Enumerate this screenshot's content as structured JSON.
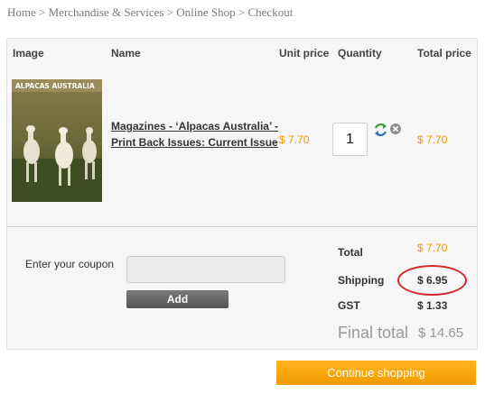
{
  "breadcrumb": {
    "items": [
      "Home",
      "Merchandise & Services",
      "Online Shop",
      "Checkout"
    ],
    "separator": " > "
  },
  "table": {
    "headers": {
      "image": "Image",
      "name": "Name",
      "unit_price": "Unit price",
      "quantity": "Quantity",
      "total_price": "Total price"
    },
    "rows": [
      {
        "name": "Magazines - ‘Alpacas Australia’ - Print Back Issues: Current Issue",
        "image_title": "ALPACAS AUSTRALIA",
        "unit_price": "$ 7.70",
        "quantity": "1",
        "total": "$ 7.70",
        "icons": [
          "refresh-icon",
          "remove-icon"
        ]
      }
    ]
  },
  "coupon": {
    "label": "Enter your coupon",
    "placeholder": "",
    "button_label": "Add"
  },
  "summary": {
    "total_label": "Total",
    "total_value": "$ 7.70",
    "shipping_label": "Shipping",
    "shipping_value": "$ 6.95",
    "gst_label": "GST",
    "gst_value": "$ 1.33",
    "final_label": "Final total",
    "final_value": "$ 14.65"
  },
  "actions": {
    "continue_label": "Continue shopping"
  },
  "colors": {
    "accent": "#f19500",
    "highlight_circle": "#d8242a",
    "button_gray": "#666666"
  }
}
